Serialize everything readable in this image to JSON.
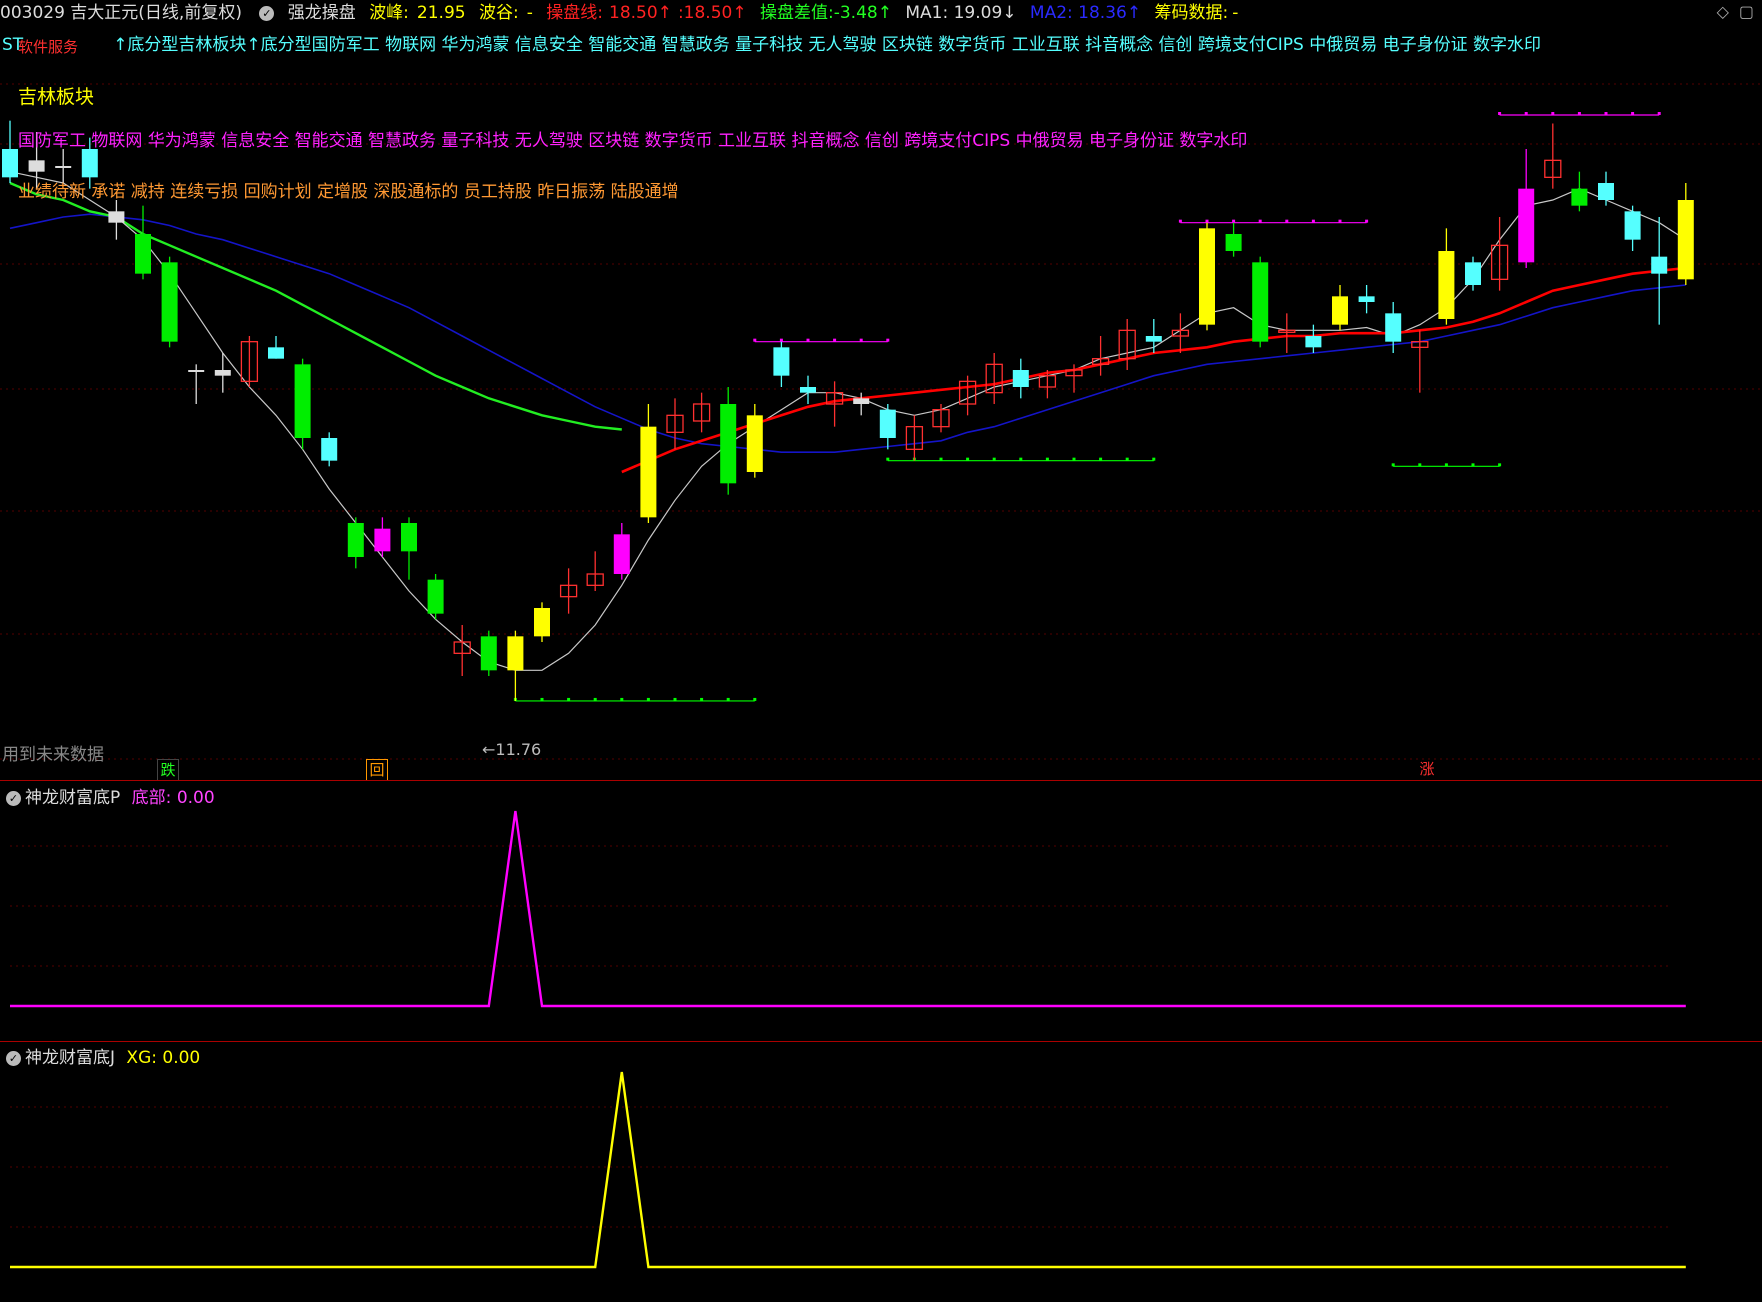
{
  "header": {
    "code_title": "003029 吉大正元(日线,前复权)",
    "indicator": "强龙操盘",
    "peak_label": "波峰:",
    "peak_value": "21.95",
    "valley_label": "波谷:",
    "valley_value": "-",
    "line_label": "操盘线:",
    "line_value": "18.50↑",
    "line_value2": ":18.50↑",
    "diff_label": "操盘差值:",
    "diff_value": "-3.48↑",
    "ma1": "MA1: 19.09↓",
    "ma2": "MA2: 18.36↑",
    "chip": "筹码数据:",
    "chip_value": "-"
  },
  "tags_row1_lead": "ST",
  "tags_row1_overlay": "软件服务",
  "tags_row1": "↑底分型吉林板块↑底分型国防军工 物联网 华为鸿蒙 信息安全 智能交通 智慧政务 量子科技 无人驾驶 区块链 数字货币 工业互联 抖音概念 信创 跨境支付CIPS 中俄贸易 电子身份证 数字水印",
  "tags_region": "吉林板块",
  "tags_concepts": "国防军工 物联网 华为鸿蒙 信息安全 智能交通 智慧政务 量子科技 无人驾驶 区块链 数字货币 工业互联 抖音概念 信创 跨境支付CIPS 中俄贸易 电子身份证 数字水印",
  "tags_events": "业绩待新 承诺 减持 连续亏损 回购计划 定增股 深股通标的 员工持股 昨日振荡 陆股通增",
  "main": {
    "low_label": "←11.76",
    "future_note": "用到未来数据",
    "marker_down": "跌",
    "marker_mid": "回",
    "marker_up": "涨"
  },
  "panel1": {
    "name": "神龙财富底P",
    "var": "底部:",
    "value": "0.00"
  },
  "panel2": {
    "name": "神龙财富底J",
    "var": "XG:",
    "value": "0.00"
  },
  "colors": {
    "bg": "#000000",
    "up_hollow": "#ff3030",
    "down_green": "#00ee00",
    "cyan": "#55ffff",
    "yellow": "#ffff00",
    "magenta": "#ff00ff",
    "ma_red": "#ff0000",
    "ma_green": "#22ee22",
    "ma_blue": "#1414c8",
    "ma_white": "#c8c8c8",
    "grid": "#550000"
  },
  "chart_data": {
    "type": "candlestick",
    "y_range": [
      11.0,
      23.0
    ],
    "candles": [
      {
        "o": 21.5,
        "h": 22.0,
        "l": 20.9,
        "c": 21.0,
        "k": "cyan"
      },
      {
        "o": 21.1,
        "h": 21.8,
        "l": 20.8,
        "c": 21.3,
        "k": "white"
      },
      {
        "o": 21.2,
        "h": 21.5,
        "l": 20.9,
        "c": 21.2,
        "k": "white"
      },
      {
        "o": 21.5,
        "h": 21.7,
        "l": 20.8,
        "c": 21.0,
        "k": "cyan"
      },
      {
        "o": 20.4,
        "h": 20.6,
        "l": 19.9,
        "c": 20.2,
        "k": "white"
      },
      {
        "o": 20.0,
        "h": 20.5,
        "l": 19.2,
        "c": 19.3,
        "k": "green"
      },
      {
        "o": 19.5,
        "h": 19.6,
        "l": 18.0,
        "c": 18.1,
        "k": "green"
      },
      {
        "o": 17.6,
        "h": 17.7,
        "l": 17.0,
        "c": 17.6,
        "k": "white"
      },
      {
        "o": 17.5,
        "h": 17.9,
        "l": 17.2,
        "c": 17.6,
        "k": "white"
      },
      {
        "o": 17.4,
        "h": 18.2,
        "l": 17.3,
        "c": 18.1,
        "k": "red"
      },
      {
        "o": 18.0,
        "h": 18.2,
        "l": 17.8,
        "c": 17.8,
        "k": "cyan"
      },
      {
        "o": 17.7,
        "h": 17.8,
        "l": 16.2,
        "c": 16.4,
        "k": "green"
      },
      {
        "o": 16.4,
        "h": 16.5,
        "l": 15.9,
        "c": 16.0,
        "k": "cyan"
      },
      {
        "o": 14.9,
        "h": 15.0,
        "l": 14.1,
        "c": 14.3,
        "k": "green"
      },
      {
        "o": 14.8,
        "h": 15.0,
        "l": 14.3,
        "c": 14.4,
        "k": "magenta"
      },
      {
        "o": 14.9,
        "h": 15.0,
        "l": 13.9,
        "c": 14.4,
        "k": "green"
      },
      {
        "o": 13.9,
        "h": 14.0,
        "l": 13.2,
        "c": 13.3,
        "k": "green"
      },
      {
        "o": 12.8,
        "h": 13.1,
        "l": 12.2,
        "c": 12.6,
        "k": "red"
      },
      {
        "o": 12.9,
        "h": 13.0,
        "l": 12.2,
        "c": 12.3,
        "k": "green"
      },
      {
        "o": 12.3,
        "h": 13.0,
        "l": 11.76,
        "c": 12.9,
        "k": "yellow"
      },
      {
        "o": 13.4,
        "h": 13.5,
        "l": 12.8,
        "c": 12.9,
        "k": "yellow"
      },
      {
        "o": 13.8,
        "h": 14.1,
        "l": 13.3,
        "c": 13.6,
        "k": "red"
      },
      {
        "o": 13.8,
        "h": 14.4,
        "l": 13.7,
        "c": 14.0,
        "k": "red"
      },
      {
        "o": 14.0,
        "h": 14.9,
        "l": 13.9,
        "c": 14.7,
        "k": "magenta"
      },
      {
        "o": 15.0,
        "h": 17.0,
        "l": 14.9,
        "c": 16.6,
        "k": "yellow"
      },
      {
        "o": 16.5,
        "h": 17.1,
        "l": 16.2,
        "c": 16.8,
        "k": "red"
      },
      {
        "o": 16.7,
        "h": 17.2,
        "l": 16.5,
        "c": 17.0,
        "k": "red"
      },
      {
        "o": 17.0,
        "h": 17.3,
        "l": 15.4,
        "c": 15.6,
        "k": "green"
      },
      {
        "o": 15.8,
        "h": 17.0,
        "l": 15.7,
        "c": 16.8,
        "k": "yellow"
      },
      {
        "o": 18.0,
        "h": 18.1,
        "l": 17.3,
        "c": 17.5,
        "k": "cyan"
      },
      {
        "o": 17.3,
        "h": 17.5,
        "l": 17.0,
        "c": 17.2,
        "k": "cyan"
      },
      {
        "o": 17.0,
        "h": 17.4,
        "l": 16.6,
        "c": 17.2,
        "k": "red"
      },
      {
        "o": 17.0,
        "h": 17.2,
        "l": 16.8,
        "c": 17.1,
        "k": "white"
      },
      {
        "o": 16.9,
        "h": 17.0,
        "l": 16.2,
        "c": 16.4,
        "k": "cyan"
      },
      {
        "o": 16.2,
        "h": 16.8,
        "l": 16.0,
        "c": 16.6,
        "k": "red"
      },
      {
        "o": 16.6,
        "h": 17.0,
        "l": 16.5,
        "c": 16.9,
        "k": "red"
      },
      {
        "o": 17.0,
        "h": 17.5,
        "l": 16.8,
        "c": 17.4,
        "k": "red"
      },
      {
        "o": 17.2,
        "h": 17.9,
        "l": 17.0,
        "c": 17.7,
        "k": "red"
      },
      {
        "o": 17.6,
        "h": 17.8,
        "l": 17.1,
        "c": 17.3,
        "k": "cyan"
      },
      {
        "o": 17.3,
        "h": 17.6,
        "l": 17.1,
        "c": 17.5,
        "k": "red"
      },
      {
        "o": 17.5,
        "h": 17.7,
        "l": 17.2,
        "c": 17.6,
        "k": "red"
      },
      {
        "o": 17.7,
        "h": 18.2,
        "l": 17.5,
        "c": 17.8,
        "k": "red"
      },
      {
        "o": 17.8,
        "h": 18.5,
        "l": 17.6,
        "c": 18.3,
        "k": "red"
      },
      {
        "o": 18.2,
        "h": 18.5,
        "l": 17.9,
        "c": 18.1,
        "k": "cyan"
      },
      {
        "o": 18.3,
        "h": 18.6,
        "l": 17.9,
        "c": 18.2,
        "k": "red"
      },
      {
        "o": 18.4,
        "h": 20.2,
        "l": 18.3,
        "c": 20.1,
        "k": "yellow"
      },
      {
        "o": 20.0,
        "h": 20.2,
        "l": 19.6,
        "c": 19.7,
        "k": "green"
      },
      {
        "o": 19.5,
        "h": 19.6,
        "l": 18.0,
        "c": 18.1,
        "k": "green"
      },
      {
        "o": 18.3,
        "h": 18.6,
        "l": 17.9,
        "c": 18.3,
        "k": "red"
      },
      {
        "o": 18.2,
        "h": 18.4,
        "l": 17.9,
        "c": 18.0,
        "k": "cyan"
      },
      {
        "o": 18.4,
        "h": 19.1,
        "l": 18.3,
        "c": 18.9,
        "k": "yellow"
      },
      {
        "o": 18.9,
        "h": 19.1,
        "l": 18.6,
        "c": 18.8,
        "k": "cyan"
      },
      {
        "o": 18.6,
        "h": 18.8,
        "l": 17.9,
        "c": 18.1,
        "k": "cyan"
      },
      {
        "o": 18.0,
        "h": 18.3,
        "l": 17.2,
        "c": 18.1,
        "k": "red"
      },
      {
        "o": 18.5,
        "h": 20.1,
        "l": 18.4,
        "c": 19.7,
        "k": "yellow"
      },
      {
        "o": 19.5,
        "h": 19.6,
        "l": 19.0,
        "c": 19.1,
        "k": "cyan"
      },
      {
        "o": 19.2,
        "h": 20.3,
        "l": 19.0,
        "c": 19.8,
        "k": "red"
      },
      {
        "o": 19.5,
        "h": 21.5,
        "l": 19.4,
        "c": 20.8,
        "k": "magenta"
      },
      {
        "o": 21.0,
        "h": 21.95,
        "l": 20.8,
        "c": 21.3,
        "k": "red"
      },
      {
        "o": 20.8,
        "h": 21.1,
        "l": 20.4,
        "c": 20.5,
        "k": "green"
      },
      {
        "o": 20.9,
        "h": 21.1,
        "l": 20.5,
        "c": 20.6,
        "k": "cyan"
      },
      {
        "o": 20.4,
        "h": 20.5,
        "l": 19.7,
        "c": 19.9,
        "k": "cyan"
      },
      {
        "o": 19.6,
        "h": 20.3,
        "l": 18.4,
        "c": 19.3,
        "k": "cyan"
      },
      {
        "o": 19.2,
        "h": 20.9,
        "l": 19.1,
        "c": 20.6,
        "k": "yellow"
      }
    ],
    "ma_red_values": [
      null,
      null,
      null,
      null,
      null,
      null,
      null,
      null,
      null,
      null,
      null,
      null,
      null,
      null,
      null,
      null,
      null,
      null,
      null,
      null,
      null,
      null,
      null,
      15.8,
      16.0,
      16.2,
      16.35,
      16.5,
      16.65,
      16.8,
      16.95,
      17.05,
      17.1,
      17.15,
      17.2,
      17.25,
      17.3,
      17.35,
      17.45,
      17.55,
      17.6,
      17.7,
      17.8,
      17.9,
      17.95,
      18.0,
      18.1,
      18.15,
      18.2,
      18.2,
      18.25,
      18.25,
      18.25,
      18.3,
      18.35,
      18.45,
      18.6,
      18.8,
      19.0,
      19.1,
      19.2,
      19.3,
      19.35,
      19.4
    ],
    "ma_green_values": [
      20.9,
      20.7,
      20.6,
      20.4,
      20.3,
      20.0,
      19.8,
      19.6,
      19.4,
      19.2,
      19.0,
      18.75,
      18.5,
      18.25,
      18.0,
      17.75,
      17.5,
      17.3,
      17.1,
      16.95,
      16.8,
      16.7,
      16.6,
      16.55
    ],
    "ma_blue_values": [
      20.1,
      20.2,
      20.3,
      20.35,
      20.3,
      20.25,
      20.15,
      20.0,
      19.9,
      19.75,
      19.6,
      19.45,
      19.3,
      19.1,
      18.9,
      18.7,
      18.45,
      18.2,
      17.95,
      17.7,
      17.45,
      17.2,
      16.95,
      16.75,
      16.55,
      16.4,
      16.3,
      16.25,
      16.2,
      16.15,
      16.15,
      16.15,
      16.2,
      16.25,
      16.3,
      16.35,
      16.5,
      16.6,
      16.75,
      16.9,
      17.05,
      17.2,
      17.35,
      17.5,
      17.6,
      17.7,
      17.75,
      17.8,
      17.85,
      17.9,
      17.95,
      18.0,
      18.05,
      18.1,
      18.2,
      18.3,
      18.4,
      18.55,
      18.7,
      18.8,
      18.9,
      19.0,
      19.05,
      19.1
    ],
    "ma_white_values": [
      21.1,
      21.0,
      20.9,
      20.6,
      20.3,
      19.9,
      19.3,
      18.6,
      17.9,
      17.3,
      16.8,
      16.2,
      15.5,
      14.9,
      14.3,
      13.7,
      13.2,
      12.8,
      12.45,
      12.3,
      12.3,
      12.6,
      13.1,
      13.8,
      14.6,
      15.3,
      15.9,
      16.3,
      16.6,
      16.9,
      17.2,
      17.2,
      17.1,
      16.9,
      16.8,
      16.9,
      17.1,
      17.3,
      17.4,
      17.5,
      17.6,
      17.8,
      17.9,
      18.0,
      18.3,
      18.6,
      18.7,
      18.4,
      18.3,
      18.3,
      18.3,
      18.35,
      18.2,
      18.4,
      18.7,
      19.2,
      19.9,
      20.5,
      20.6,
      20.8,
      20.6,
      20.4,
      20.2,
      19.9
    ],
    "resistance_levels": [
      {
        "start": 28,
        "end": 33,
        "price": 18.1,
        "color": "#ff00ff"
      },
      {
        "start": 44,
        "end": 51,
        "price": 20.2,
        "color": "#ff00ff"
      },
      {
        "start": 56,
        "end": 62,
        "price": 22.1,
        "color": "#ff00ff"
      }
    ],
    "support_levels": [
      {
        "start": 19,
        "end": 28,
        "price": 11.76,
        "color": "#00ff00"
      },
      {
        "start": 33,
        "end": 43,
        "price": 16.0,
        "color": "#00ff00"
      },
      {
        "start": 52,
        "end": 56,
        "price": 15.9,
        "color": "#00ff00"
      }
    ],
    "panel1_series": {
      "peak_index": 19,
      "peak_value": 1,
      "base": 0
    },
    "panel2_series": {
      "peak_index": 23,
      "peak_value": 1,
      "base": 0
    }
  }
}
